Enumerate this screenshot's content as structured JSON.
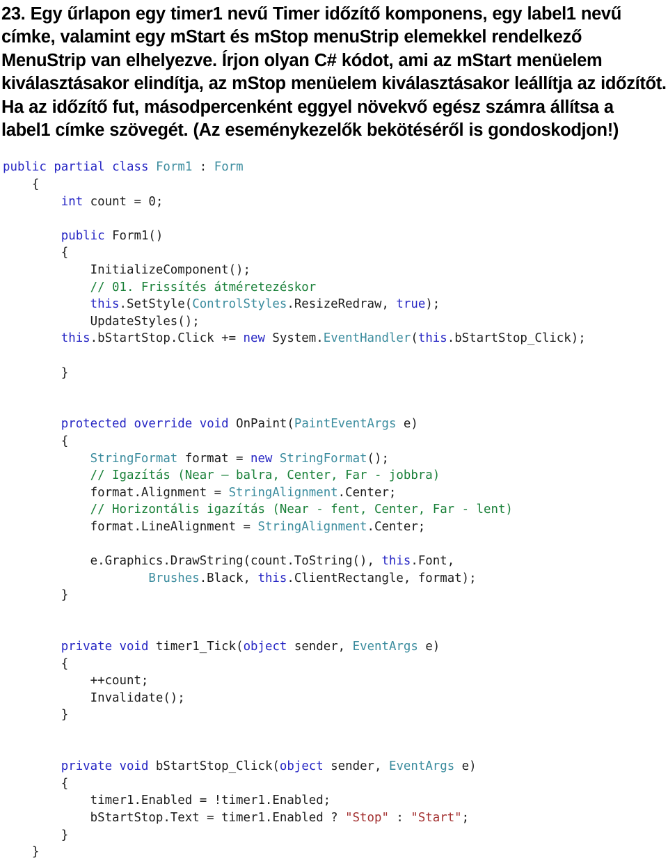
{
  "document": {
    "language": "hu",
    "question_number": "23.",
    "prompt_paragraph": "23. Egy  űrlapon egy timer1 nevű Timer  időzítő komponens, egy label1 nevű címke,  valamint egy mStart  és mStop menuStrip elemekkel rendelkező MenuStrip van elhelyezve. Írjon olyan C# kódot, ami az mStart menüelem kiválasztásakor elindítja, az mStop menüelem kiválasztásakor leállítja az időzítőt. Ha az időzítő fut, másodpercenként eggyel növekvő egész számra állítsa a label1 címke szövegét. (Az eseménykezelők bekötéséről is gondoskodjon!)",
    "prompt_lines": [
      "23. Egy  űrlapon egy timer1 nevű Timer  időzítő komponens, egy label1",
      "nevű címke,  valamint egy mStart  és mStop menuStrip elemekkel",
      "rendelkező MenuStrip van elhelyezve. Írjon olyan C# kódot, ami az",
      "mStart menüelem kiválasztásakor elindítja, az mStop menüelem",
      "kiválasztásakor leállítja az időzítőt. Ha az időzítő fut, másodpercenként",
      "eggyel növekvő egész számra állítsa a label1 címke szövegét. (Az",
      "eseménykezelők bekötéséről is gondoskodjon!)"
    ]
  },
  "colors": {
    "background": "#ffffff",
    "text": "#000000",
    "code_plain": "#1c1c1c",
    "keyword": "#2626c4",
    "type": "#3b8c9e",
    "comment": "#198038",
    "string": "#a33030"
  },
  "code": {
    "language": "csharp",
    "lines": [
      {
        "indent": 0,
        "tokens": [
          {
            "c": "k",
            "v": "public"
          },
          {
            "c": "p",
            "v": " "
          },
          {
            "c": "k",
            "v": "partial"
          },
          {
            "c": "p",
            "v": " "
          },
          {
            "c": "k",
            "v": "class"
          },
          {
            "c": "p",
            "v": " "
          },
          {
            "c": "t",
            "v": "Form1"
          },
          {
            "c": "p",
            "v": " : "
          },
          {
            "c": "t",
            "v": "Form"
          }
        ]
      },
      {
        "indent": 1,
        "tokens": [
          {
            "c": "p",
            "v": "{"
          }
        ]
      },
      {
        "indent": 2,
        "tokens": [
          {
            "c": "k",
            "v": "int"
          },
          {
            "c": "p",
            "v": " count = 0;"
          }
        ]
      },
      {
        "indent": 0,
        "tokens": []
      },
      {
        "indent": 2,
        "tokens": [
          {
            "c": "k",
            "v": "public"
          },
          {
            "c": "p",
            "v": " Form1()"
          }
        ]
      },
      {
        "indent": 2,
        "tokens": [
          {
            "c": "p",
            "v": "{"
          }
        ]
      },
      {
        "indent": 3,
        "tokens": [
          {
            "c": "p",
            "v": "InitializeComponent();"
          }
        ]
      },
      {
        "indent": 3,
        "tokens": [
          {
            "c": "c",
            "v": "// 01. Frissítés átméretezéskor"
          }
        ]
      },
      {
        "indent": 3,
        "tokens": [
          {
            "c": "k",
            "v": "this"
          },
          {
            "c": "p",
            "v": ".SetStyle("
          },
          {
            "c": "t",
            "v": "ControlStyles"
          },
          {
            "c": "p",
            "v": ".ResizeRedraw, "
          },
          {
            "c": "k",
            "v": "true"
          },
          {
            "c": "p",
            "v": ");"
          }
        ]
      },
      {
        "indent": 3,
        "tokens": [
          {
            "c": "p",
            "v": "UpdateStyles();"
          }
        ]
      },
      {
        "indent": 2,
        "tokens": [
          {
            "c": "k",
            "v": "this"
          },
          {
            "c": "p",
            "v": ".bStartStop.Click += "
          },
          {
            "c": "k",
            "v": "new"
          },
          {
            "c": "p",
            "v": " System."
          },
          {
            "c": "t",
            "v": "EventHandler"
          },
          {
            "c": "p",
            "v": "("
          },
          {
            "c": "k",
            "v": "this"
          },
          {
            "c": "p",
            "v": ".bStartStop_Click);"
          }
        ]
      },
      {
        "indent": 0,
        "tokens": []
      },
      {
        "indent": 2,
        "tokens": [
          {
            "c": "p",
            "v": "}"
          }
        ]
      },
      {
        "indent": 0,
        "tokens": []
      },
      {
        "indent": 0,
        "tokens": []
      },
      {
        "indent": 2,
        "tokens": [
          {
            "c": "k",
            "v": "protected"
          },
          {
            "c": "p",
            "v": " "
          },
          {
            "c": "k",
            "v": "override"
          },
          {
            "c": "p",
            "v": " "
          },
          {
            "c": "k",
            "v": "void"
          },
          {
            "c": "p",
            "v": " OnPaint("
          },
          {
            "c": "t",
            "v": "PaintEventArgs"
          },
          {
            "c": "p",
            "v": " e)"
          }
        ]
      },
      {
        "indent": 2,
        "tokens": [
          {
            "c": "p",
            "v": "{"
          }
        ]
      },
      {
        "indent": 3,
        "tokens": [
          {
            "c": "t",
            "v": "StringFormat"
          },
          {
            "c": "p",
            "v": " format = "
          },
          {
            "c": "k",
            "v": "new"
          },
          {
            "c": "p",
            "v": " "
          },
          {
            "c": "t",
            "v": "StringFormat"
          },
          {
            "c": "p",
            "v": "();"
          }
        ]
      },
      {
        "indent": 3,
        "tokens": [
          {
            "c": "c",
            "v": "// Igazítás (Near – balra, Center, Far - jobbra)"
          }
        ]
      },
      {
        "indent": 3,
        "tokens": [
          {
            "c": "p",
            "v": "format.Alignment = "
          },
          {
            "c": "t",
            "v": "StringAlignment"
          },
          {
            "c": "p",
            "v": ".Center;"
          }
        ]
      },
      {
        "indent": 3,
        "tokens": [
          {
            "c": "c",
            "v": "// Horizontális igazítás (Near - fent, Center, Far - lent)"
          }
        ]
      },
      {
        "indent": 3,
        "tokens": [
          {
            "c": "p",
            "v": "format.LineAlignment = "
          },
          {
            "c": "t",
            "v": "StringAlignment"
          },
          {
            "c": "p",
            "v": ".Center;"
          }
        ]
      },
      {
        "indent": 0,
        "tokens": []
      },
      {
        "indent": 3,
        "tokens": [
          {
            "c": "p",
            "v": "e.Graphics.DrawString(count.ToString(), "
          },
          {
            "c": "k",
            "v": "this"
          },
          {
            "c": "p",
            "v": ".Font,"
          }
        ]
      },
      {
        "indent": 5,
        "tokens": [
          {
            "c": "t",
            "v": "Brushes"
          },
          {
            "c": "p",
            "v": ".Black, "
          },
          {
            "c": "k",
            "v": "this"
          },
          {
            "c": "p",
            "v": ".ClientRectangle, format);"
          }
        ]
      },
      {
        "indent": 2,
        "tokens": [
          {
            "c": "p",
            "v": "}"
          }
        ]
      },
      {
        "indent": 0,
        "tokens": []
      },
      {
        "indent": 0,
        "tokens": []
      },
      {
        "indent": 2,
        "tokens": [
          {
            "c": "k",
            "v": "private"
          },
          {
            "c": "p",
            "v": " "
          },
          {
            "c": "k",
            "v": "void"
          },
          {
            "c": "p",
            "v": " timer1_Tick("
          },
          {
            "c": "k",
            "v": "object"
          },
          {
            "c": "p",
            "v": " sender, "
          },
          {
            "c": "t",
            "v": "EventArgs"
          },
          {
            "c": "p",
            "v": " e)"
          }
        ]
      },
      {
        "indent": 2,
        "tokens": [
          {
            "c": "p",
            "v": "{"
          }
        ]
      },
      {
        "indent": 3,
        "tokens": [
          {
            "c": "p",
            "v": "++count;"
          }
        ]
      },
      {
        "indent": 3,
        "tokens": [
          {
            "c": "p",
            "v": "Invalidate();"
          }
        ]
      },
      {
        "indent": 2,
        "tokens": [
          {
            "c": "p",
            "v": "}"
          }
        ]
      },
      {
        "indent": 0,
        "tokens": []
      },
      {
        "indent": 0,
        "tokens": []
      },
      {
        "indent": 2,
        "tokens": [
          {
            "c": "k",
            "v": "private"
          },
          {
            "c": "p",
            "v": " "
          },
          {
            "c": "k",
            "v": "void"
          },
          {
            "c": "p",
            "v": " bStartStop_Click("
          },
          {
            "c": "k",
            "v": "object"
          },
          {
            "c": "p",
            "v": " sender, "
          },
          {
            "c": "t",
            "v": "EventArgs"
          },
          {
            "c": "p",
            "v": " e)"
          }
        ]
      },
      {
        "indent": 2,
        "tokens": [
          {
            "c": "p",
            "v": "{"
          }
        ]
      },
      {
        "indent": 3,
        "tokens": [
          {
            "c": "p",
            "v": "timer1.Enabled = !timer1.Enabled;"
          }
        ]
      },
      {
        "indent": 3,
        "tokens": [
          {
            "c": "p",
            "v": "bStartStop.Text = timer1.Enabled ? "
          },
          {
            "c": "s",
            "v": "\"Stop\""
          },
          {
            "c": "p",
            "v": " : "
          },
          {
            "c": "s",
            "v": "\"Start\""
          },
          {
            "c": "p",
            "v": ";"
          }
        ]
      },
      {
        "indent": 2,
        "tokens": [
          {
            "c": "p",
            "v": "}"
          }
        ]
      },
      {
        "indent": 1,
        "tokens": [
          {
            "c": "p",
            "v": "}"
          }
        ]
      }
    ]
  }
}
